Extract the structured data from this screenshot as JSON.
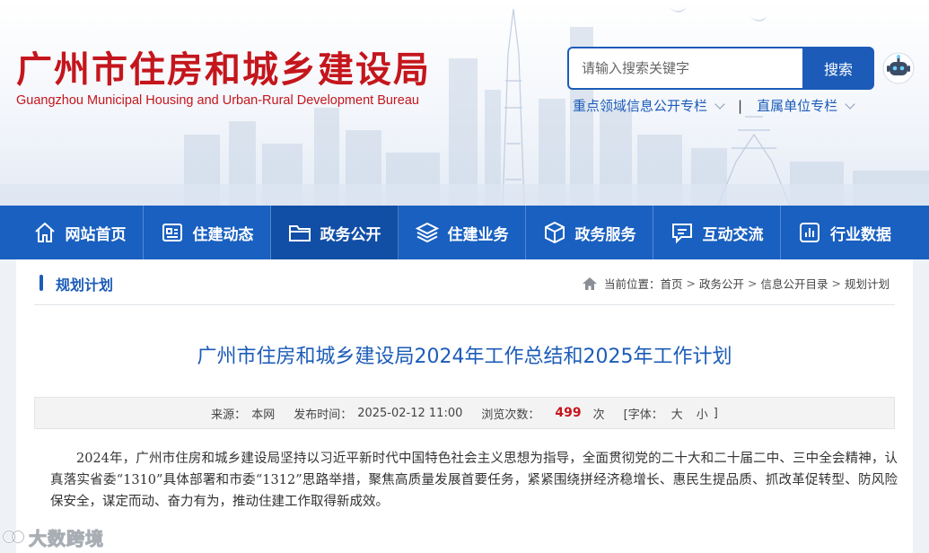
{
  "header": {
    "title": "广州市住房和城乡建设局",
    "subtitle": "Guangzhou Municipal Housing and Urban-Rural Development Bureau",
    "search_placeholder": "请输入搜索关键字",
    "search_button": "搜索",
    "quick_links": [
      "重点领域信息公开专栏",
      "直属单位专栏"
    ],
    "separator": "|"
  },
  "nav": {
    "items": [
      {
        "label": "网站首页",
        "icon": "home-icon"
      },
      {
        "label": "住建动态",
        "icon": "news-icon"
      },
      {
        "label": "政务公开",
        "icon": "folder-icon",
        "active": true
      },
      {
        "label": "住建业务",
        "icon": "layers-icon"
      },
      {
        "label": "政务服务",
        "icon": "box-icon"
      },
      {
        "label": "互动交流",
        "icon": "chat-icon"
      },
      {
        "label": "行业数据",
        "icon": "chart-icon"
      }
    ]
  },
  "section": {
    "title": "规划计划"
  },
  "breadcrumb": {
    "prefix": "当前位置：",
    "items": [
      "首页",
      "政务公开",
      "信息公开目录",
      "规划计划"
    ],
    "arrow": ">"
  },
  "article": {
    "title": "广州市住房和城乡建设局2024年工作总结和2025年工作计划",
    "meta": {
      "source_label": "来源：",
      "source": "本网",
      "date_label": "发布时间：",
      "date": "2025-02-12 11:00",
      "views_label": "浏览次数：",
      "views": "499",
      "views_unit": "次",
      "font_label": "[字体：",
      "font_large": "大",
      "font_small": "小",
      "font_end": "]"
    },
    "paragraph": "2024年，广州市住房和城乡建设局坚持以习近平新时代中国特色社会主义思想为指导，全面贯彻党的二十大和二十届二中、三中全会精神，认真落实省委“1310”具体部署和市委“1312”思路举措，聚焦高质量发展首要任务，紧紧围绕拼经济稳增长、惠民生提品质、抓改革促转型、防风险保安全，谋定而动、奋力有为，推动住建工作取得新成效。"
  },
  "watermark": {
    "text": "大数跨境"
  },
  "colors": {
    "brand_red": "#c4161c",
    "brand_blue": "#1c5cb8",
    "nav_blue": "#1960c0"
  }
}
